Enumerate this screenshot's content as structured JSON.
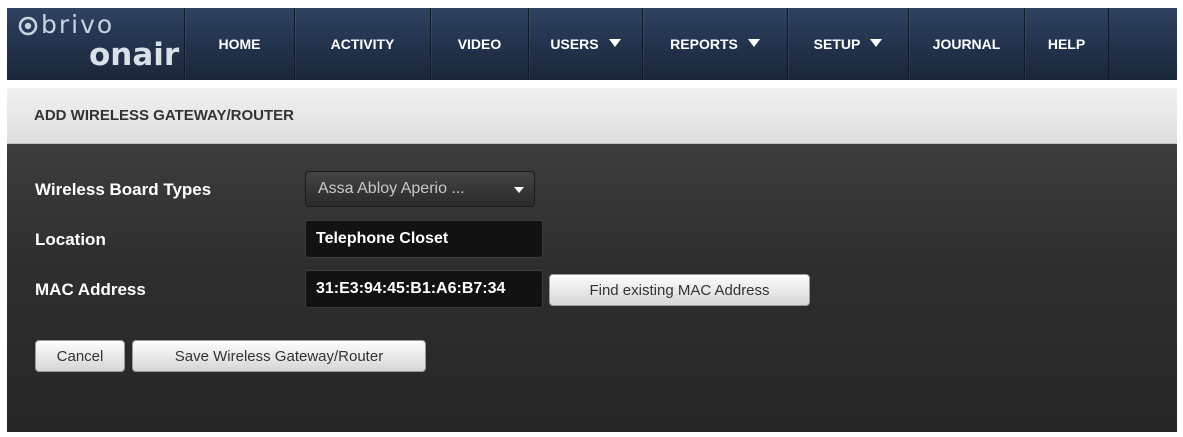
{
  "brand": {
    "logo_top": "brivo",
    "logo_bottom": "onair",
    "icon": "brivo-circle-logo-icon"
  },
  "nav": {
    "items": [
      {
        "label": "HOME",
        "dropdown": false
      },
      {
        "label": "ACTIVITY",
        "dropdown": false
      },
      {
        "label": "VIDEO",
        "dropdown": false
      },
      {
        "label": "USERS",
        "dropdown": true
      },
      {
        "label": "REPORTS",
        "dropdown": true
      },
      {
        "label": "SETUP",
        "dropdown": true
      },
      {
        "label": "JOURNAL",
        "dropdown": false
      },
      {
        "label": "HELP",
        "dropdown": false
      }
    ]
  },
  "page": {
    "title": "ADD WIRELESS GATEWAY/ROUTER"
  },
  "form": {
    "board_types": {
      "label": "Wireless Board Types",
      "value": "Assa Abloy Aperio ..."
    },
    "location": {
      "label": "Location",
      "value": "Telephone Closet"
    },
    "mac": {
      "label": "MAC Address",
      "value": "31:E3:94:45:B1:A6:B7:34",
      "find_button": "Find existing MAC Address"
    }
  },
  "actions": {
    "cancel": "Cancel",
    "save": "Save Wireless Gateway/Router"
  },
  "colors": {
    "nav_bg": "#22324b",
    "panel_bg": "#2f2f2f",
    "title_bg": "#e6e6e6"
  }
}
